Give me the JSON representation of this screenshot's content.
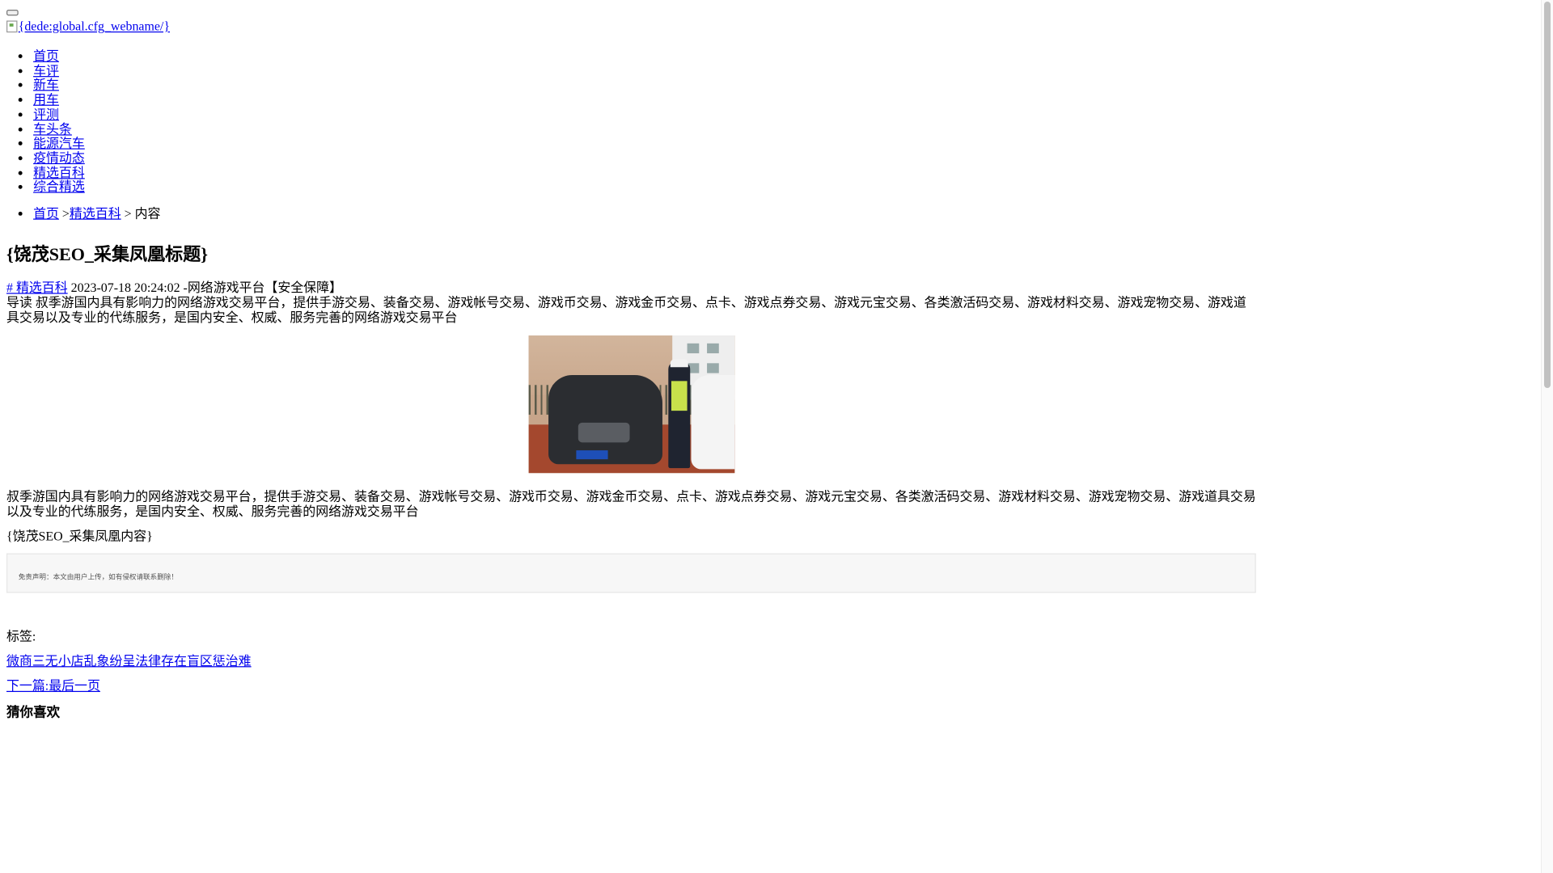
{
  "header": {
    "logo_alt": "{dede:global.cfg_webname/}"
  },
  "nav": {
    "items": [
      {
        "label": "首页"
      },
      {
        "label": "车评"
      },
      {
        "label": "新车"
      },
      {
        "label": "用车"
      },
      {
        "label": "评测"
      },
      {
        "label": "车头条"
      },
      {
        "label": "能源汽车"
      },
      {
        "label": "疫情动态"
      },
      {
        "label": "精选百科"
      },
      {
        "label": "综合精选"
      }
    ]
  },
  "breadcrumb": {
    "home": "首页",
    "sep1": " >",
    "category": "精选百科",
    "sep2": " > 内容"
  },
  "article": {
    "title": "{饶茂SEO_采集凤凰标题}",
    "tag_prefix": "# 精选百科",
    "meta_text": " 2023-07-18 20:24:02 -网络游戏平台【安全保障】",
    "lead": "导读 叔季游国内具有影响力的网络游戏交易平台，提供手游交易、装备交易、游戏帐号交易、游戏币交易、游戏金币交易、点卡、游戏点券交易、游戏元宝交易、各类激活码交易、游戏材料交易、游戏宠物交易、游戏道具交易以及专业的代练服务，是国内安全、权威、服务完善的网络游戏交易平台",
    "body": "叔季游国内具有影响力的网络游戏交易平台，提供手游交易、装备交易、游戏帐号交易、游戏币交易、游戏金币交易、点卡、游戏点券交易、游戏元宝交易、各类激活码交易、游戏材料交易、游戏宠物交易、游戏道具交易以及专业的代练服务，是国内安全、权威、服务完善的网络游戏交易平台",
    "content_placeholder": "{饶茂SEO_采集凤凰内容}",
    "disclaimer": "免责声明：本文由用户上传，如有侵权请联系删除！"
  },
  "footer": {
    "tags_label": "标签:",
    "related_link": "微商三无小店乱象纷呈法律存在盲区惩治难",
    "next_link": "下一篇:最后一页",
    "guess_heading": "猜你喜欢"
  }
}
